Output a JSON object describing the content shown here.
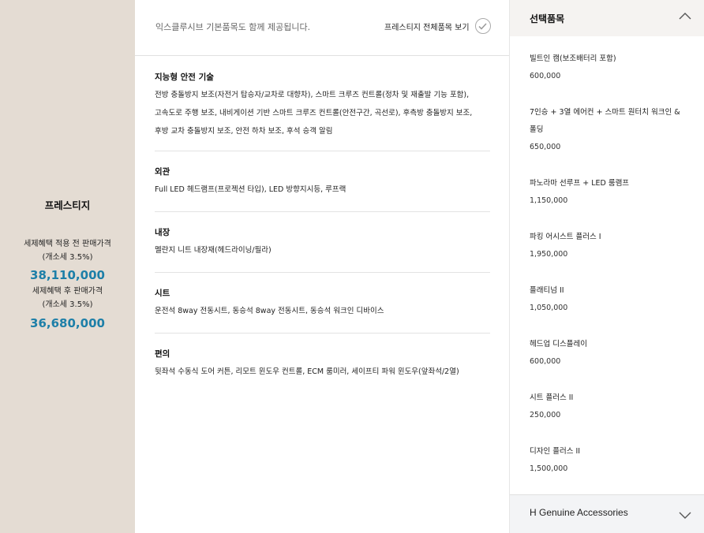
{
  "trim": {
    "name": "프레스티지",
    "price_before_label": "세제혜택 적용 전 판매가격",
    "price_before_note": "(개소세 3.5%)",
    "price_before_value": "38,110,000",
    "price_after_label": "세제혜택 후 판매가격",
    "price_after_note": "(개소세 3.5%)",
    "price_after_value": "36,680,000"
  },
  "basic": {
    "note": "익스클루시브 기본품목도 함께 제공됩니다.",
    "view_all_label": "프레스티지 전체품목 보기",
    "groups": [
      {
        "title": "지능형 안전 기술",
        "lines": [
          "전방 충돌방지 보조(자전거 탑승자/교차로 대향차), 스마트 크루즈 컨트롤(정차 및 재출발 기능 포함),",
          "고속도로 주행 보조, 내비게이션 기반 스마트 크루즈 컨트롤(안전구간, 곡선로), 후측방 충돌방지 보조,",
          "후방 교차 충돌방지 보조, 안전 하차 보조, 후석 승객 알림"
        ]
      },
      {
        "title": "외관",
        "lines": [
          "Full LED 헤드램프(프로젝션 타입), LED 방향지시등, 루프랙"
        ]
      },
      {
        "title": "내장",
        "lines": [
          "멜란지 니트 내장재(헤드라이닝/필라)"
        ]
      },
      {
        "title": "시트",
        "lines": [
          "운전석 8way 전동시트, 동승석 8way 전동시트, 동승석 워크인 디바이스"
        ]
      },
      {
        "title": "편의",
        "lines": [
          "뒷좌석 수동식 도어 커튼, 리모트 윈도우 컨트롤, ECM 룸미러, 세이프티 파워 윈도우(앞좌석/2열)"
        ]
      }
    ]
  },
  "options": {
    "title": "선택품목",
    "items": [
      {
        "name": "빌트인 캠(보조배터리 포함)",
        "price": "600,000"
      },
      {
        "name_lines": [
          "7인승 + 3열 에어컨 + 스마트 원터치 워크인 &",
          "폴딩"
        ],
        "price": "650,000"
      },
      {
        "name": "파노라마 선루프 + LED 룸램프",
        "price": "1,150,000"
      },
      {
        "name": "파킹 어시스트 플러스 I",
        "price": "1,950,000"
      },
      {
        "name": "플래티넘 II",
        "price": "1,050,000"
      },
      {
        "name": "헤드업 디스플레이",
        "price": "600,000"
      },
      {
        "name": "시트 플러스 II",
        "price": "250,000"
      },
      {
        "name": "디자인 플러스 II",
        "price": "1,500,000"
      }
    ]
  },
  "accessories": {
    "title": "H Genuine Accessories"
  },
  "icons": {
    "view_all": "check-circle-icon",
    "collapse": "chevron-up-icon",
    "expand": "chevron-down-icon"
  },
  "colors": {
    "left_panel": "#e4dcd3",
    "price_accent": "#1d7fa8",
    "options_header": "#f5f3f1"
  }
}
